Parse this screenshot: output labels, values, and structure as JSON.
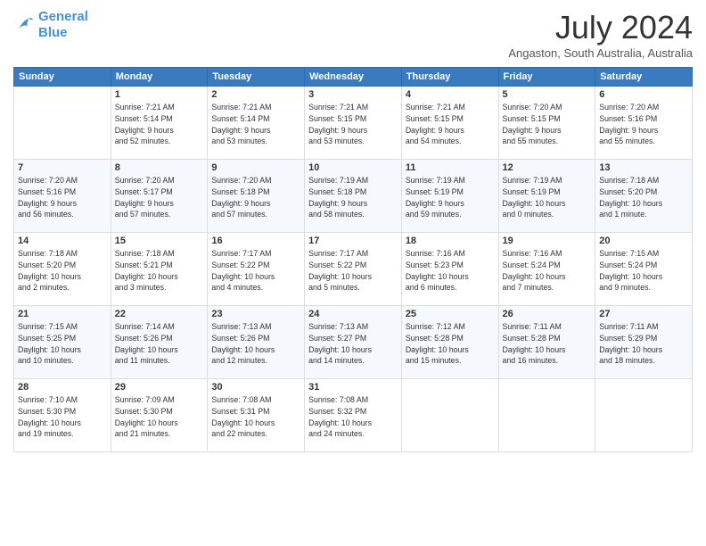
{
  "header": {
    "logo_line1": "General",
    "logo_line2": "Blue",
    "month_year": "July 2024",
    "location": "Angaston, South Australia, Australia"
  },
  "days_of_week": [
    "Sunday",
    "Monday",
    "Tuesday",
    "Wednesday",
    "Thursday",
    "Friday",
    "Saturday"
  ],
  "weeks": [
    [
      {
        "day": "",
        "info": ""
      },
      {
        "day": "1",
        "info": "Sunrise: 7:21 AM\nSunset: 5:14 PM\nDaylight: 9 hours\nand 52 minutes."
      },
      {
        "day": "2",
        "info": "Sunrise: 7:21 AM\nSunset: 5:14 PM\nDaylight: 9 hours\nand 53 minutes."
      },
      {
        "day": "3",
        "info": "Sunrise: 7:21 AM\nSunset: 5:15 PM\nDaylight: 9 hours\nand 53 minutes."
      },
      {
        "day": "4",
        "info": "Sunrise: 7:21 AM\nSunset: 5:15 PM\nDaylight: 9 hours\nand 54 minutes."
      },
      {
        "day": "5",
        "info": "Sunrise: 7:20 AM\nSunset: 5:15 PM\nDaylight: 9 hours\nand 55 minutes."
      },
      {
        "day": "6",
        "info": "Sunrise: 7:20 AM\nSunset: 5:16 PM\nDaylight: 9 hours\nand 55 minutes."
      }
    ],
    [
      {
        "day": "7",
        "info": "Sunrise: 7:20 AM\nSunset: 5:16 PM\nDaylight: 9 hours\nand 56 minutes."
      },
      {
        "day": "8",
        "info": "Sunrise: 7:20 AM\nSunset: 5:17 PM\nDaylight: 9 hours\nand 57 minutes."
      },
      {
        "day": "9",
        "info": "Sunrise: 7:20 AM\nSunset: 5:18 PM\nDaylight: 9 hours\nand 57 minutes."
      },
      {
        "day": "10",
        "info": "Sunrise: 7:19 AM\nSunset: 5:18 PM\nDaylight: 9 hours\nand 58 minutes."
      },
      {
        "day": "11",
        "info": "Sunrise: 7:19 AM\nSunset: 5:19 PM\nDaylight: 9 hours\nand 59 minutes."
      },
      {
        "day": "12",
        "info": "Sunrise: 7:19 AM\nSunset: 5:19 PM\nDaylight: 10 hours\nand 0 minutes."
      },
      {
        "day": "13",
        "info": "Sunrise: 7:18 AM\nSunset: 5:20 PM\nDaylight: 10 hours\nand 1 minute."
      }
    ],
    [
      {
        "day": "14",
        "info": "Sunrise: 7:18 AM\nSunset: 5:20 PM\nDaylight: 10 hours\nand 2 minutes."
      },
      {
        "day": "15",
        "info": "Sunrise: 7:18 AM\nSunset: 5:21 PM\nDaylight: 10 hours\nand 3 minutes."
      },
      {
        "day": "16",
        "info": "Sunrise: 7:17 AM\nSunset: 5:22 PM\nDaylight: 10 hours\nand 4 minutes."
      },
      {
        "day": "17",
        "info": "Sunrise: 7:17 AM\nSunset: 5:22 PM\nDaylight: 10 hours\nand 5 minutes."
      },
      {
        "day": "18",
        "info": "Sunrise: 7:16 AM\nSunset: 5:23 PM\nDaylight: 10 hours\nand 6 minutes."
      },
      {
        "day": "19",
        "info": "Sunrise: 7:16 AM\nSunset: 5:24 PM\nDaylight: 10 hours\nand 7 minutes."
      },
      {
        "day": "20",
        "info": "Sunrise: 7:15 AM\nSunset: 5:24 PM\nDaylight: 10 hours\nand 9 minutes."
      }
    ],
    [
      {
        "day": "21",
        "info": "Sunrise: 7:15 AM\nSunset: 5:25 PM\nDaylight: 10 hours\nand 10 minutes."
      },
      {
        "day": "22",
        "info": "Sunrise: 7:14 AM\nSunset: 5:26 PM\nDaylight: 10 hours\nand 11 minutes."
      },
      {
        "day": "23",
        "info": "Sunrise: 7:13 AM\nSunset: 5:26 PM\nDaylight: 10 hours\nand 12 minutes."
      },
      {
        "day": "24",
        "info": "Sunrise: 7:13 AM\nSunset: 5:27 PM\nDaylight: 10 hours\nand 14 minutes."
      },
      {
        "day": "25",
        "info": "Sunrise: 7:12 AM\nSunset: 5:28 PM\nDaylight: 10 hours\nand 15 minutes."
      },
      {
        "day": "26",
        "info": "Sunrise: 7:11 AM\nSunset: 5:28 PM\nDaylight: 10 hours\nand 16 minutes."
      },
      {
        "day": "27",
        "info": "Sunrise: 7:11 AM\nSunset: 5:29 PM\nDaylight: 10 hours\nand 18 minutes."
      }
    ],
    [
      {
        "day": "28",
        "info": "Sunrise: 7:10 AM\nSunset: 5:30 PM\nDaylight: 10 hours\nand 19 minutes."
      },
      {
        "day": "29",
        "info": "Sunrise: 7:09 AM\nSunset: 5:30 PM\nDaylight: 10 hours\nand 21 minutes."
      },
      {
        "day": "30",
        "info": "Sunrise: 7:08 AM\nSunset: 5:31 PM\nDaylight: 10 hours\nand 22 minutes."
      },
      {
        "day": "31",
        "info": "Sunrise: 7:08 AM\nSunset: 5:32 PM\nDaylight: 10 hours\nand 24 minutes."
      },
      {
        "day": "",
        "info": ""
      },
      {
        "day": "",
        "info": ""
      },
      {
        "day": "",
        "info": ""
      }
    ]
  ]
}
